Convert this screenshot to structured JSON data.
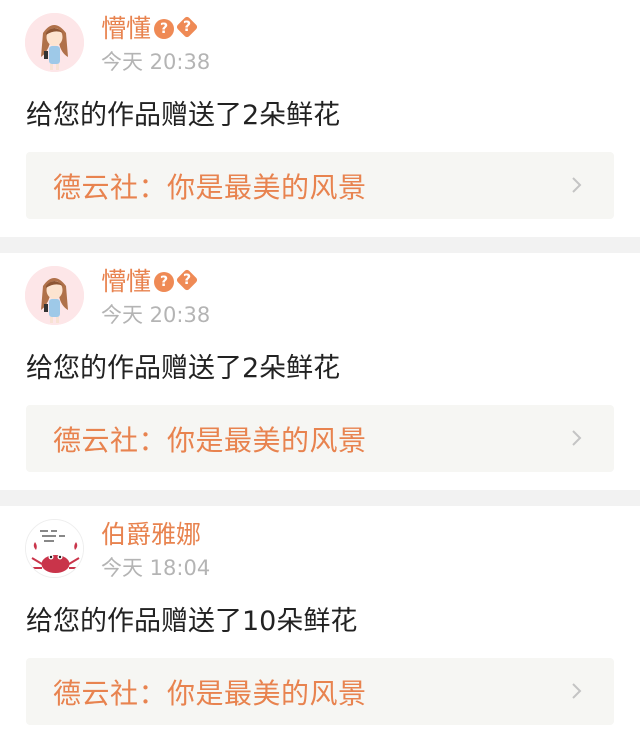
{
  "notifications": [
    {
      "username": "懵懂",
      "badges": [
        "?",
        "?"
      ],
      "timestamp": "今天 20:38",
      "message": "给您的作品赠送了2朵鲜花",
      "work_title": "德云社：你是最美的风景",
      "avatar_icon": "girl-cartoon-avatar"
    },
    {
      "username": "懵懂",
      "badges": [
        "?",
        "?"
      ],
      "timestamp": "今天 20:38",
      "message": "给您的作品赠送了2朵鲜花",
      "work_title": "德云社：你是最美的风景",
      "avatar_icon": "girl-cartoon-avatar"
    },
    {
      "username": "伯爵雅娜",
      "badges": [],
      "timestamp": "今天 18:04",
      "message": "给您的作品赠送了10朵鲜花",
      "work_title": "德云社：你是最美的风景",
      "avatar_icon": "crab-cartoon-avatar"
    }
  ],
  "colors": {
    "accent": "#e8834f",
    "timestamp": "#b4b4b4",
    "link_background": "#f6f6f3",
    "separator": "#f2f2f2"
  }
}
